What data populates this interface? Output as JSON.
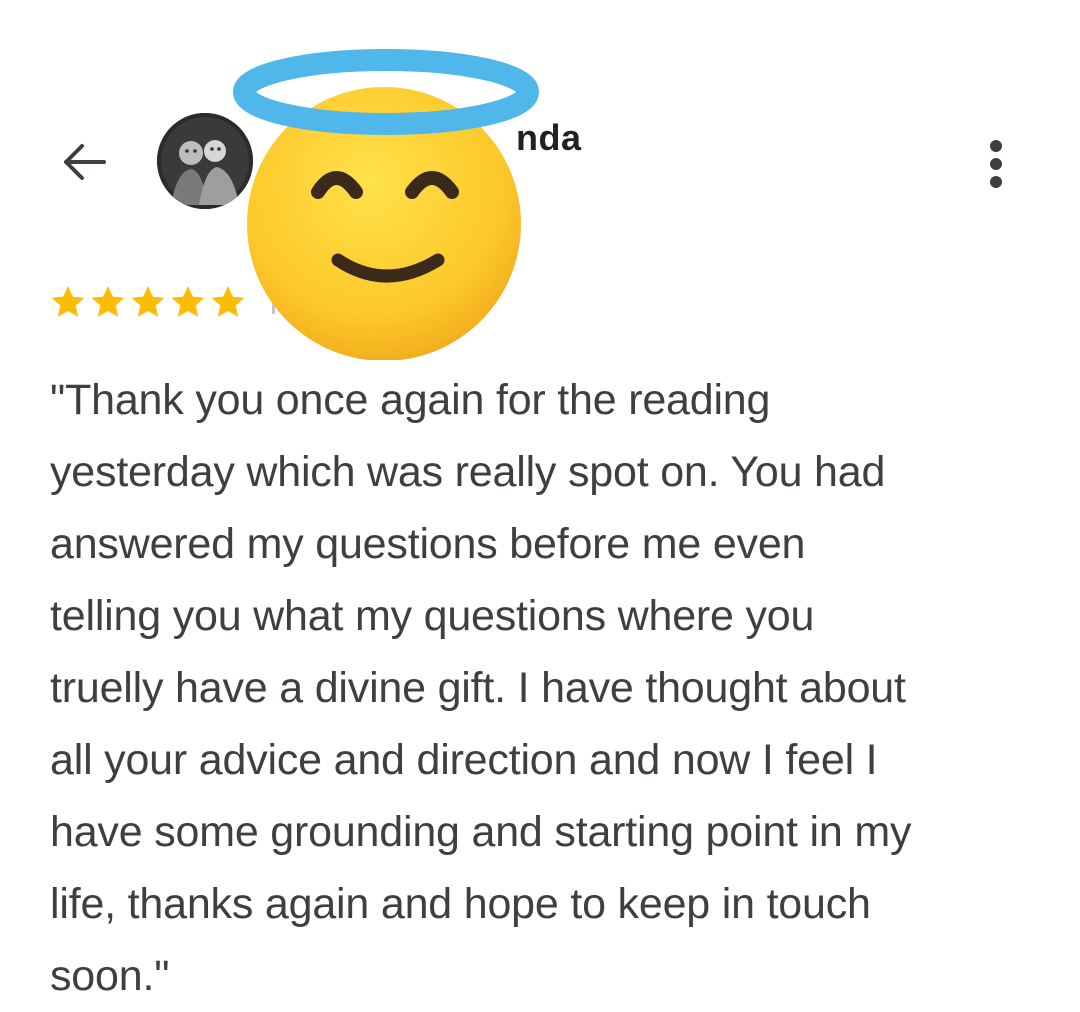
{
  "header": {
    "back_icon": "arrow-left-icon",
    "reviewer_name_partial": "nda",
    "more_icon": "more-vertical-icon"
  },
  "review": {
    "rating": 5,
    "rating_max": 5,
    "star_color": "#fbbc04",
    "text": "\"Thank you once again for the reading\nyesterday which was really spot on. You had\nanswered my questions before me even\ntelling you what my questions where you\ntruelly have a divine gift. I have thought about\nall your advice and direction and now I feel I\nhave some grounding and starting point in my\nlife, thanks again and hope to keep in touch\nsoon.\""
  },
  "overlay": {
    "emoji": "smiling-face-with-halo-icon"
  }
}
